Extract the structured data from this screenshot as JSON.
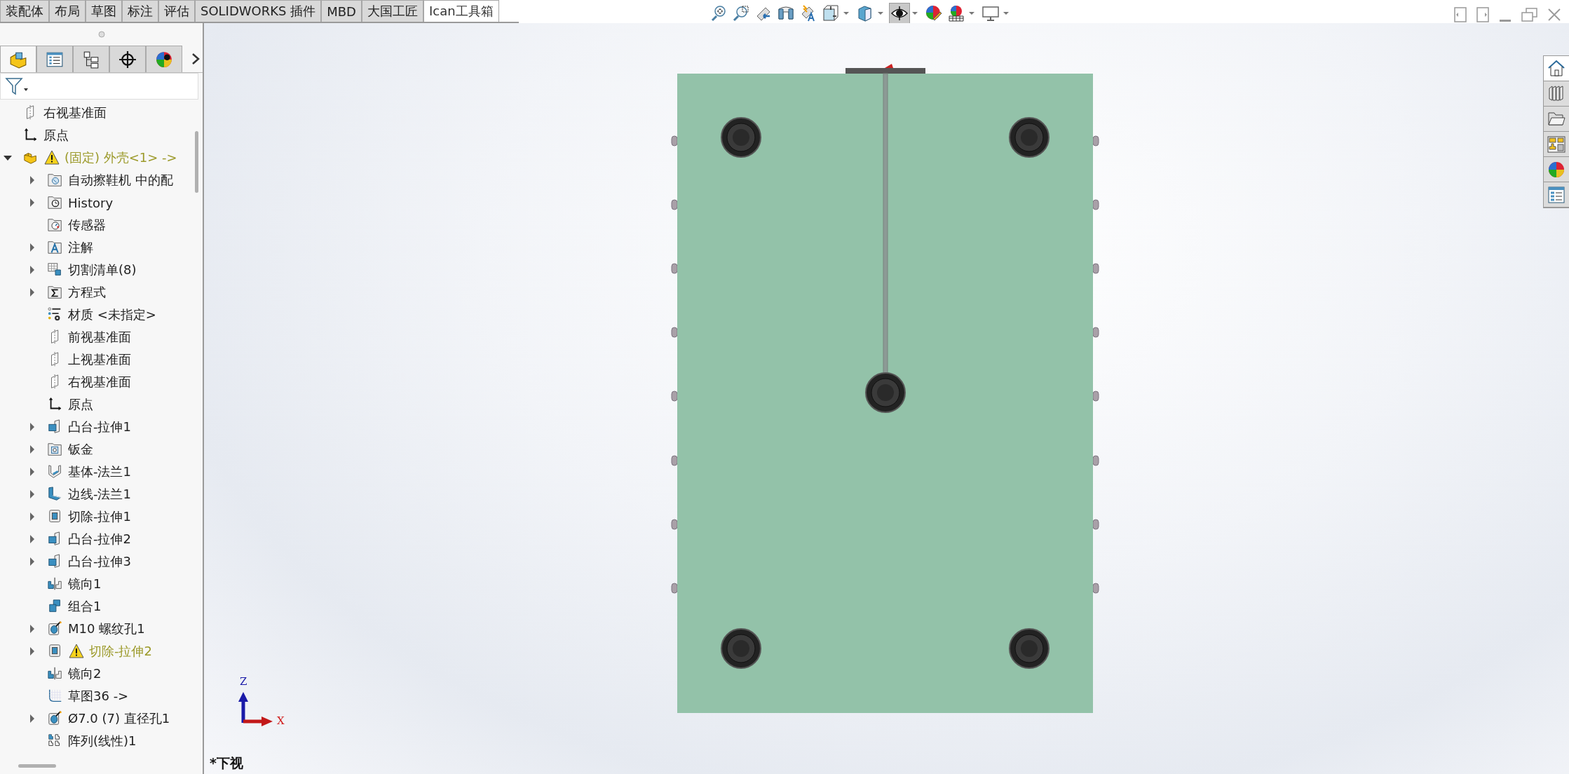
{
  "tabs": [
    {
      "label": "装配体",
      "selected": false
    },
    {
      "label": "布局",
      "selected": false
    },
    {
      "label": "草图",
      "selected": false
    },
    {
      "label": "标注",
      "selected": false
    },
    {
      "label": "评估",
      "selected": false
    },
    {
      "label": "SOLIDWORKS 插件",
      "selected": false
    },
    {
      "label": "MBD",
      "selected": false
    },
    {
      "label": "大国工匠",
      "selected": false
    },
    {
      "label": "Ican工具箱",
      "selected": true
    }
  ],
  "toolbar": [
    {
      "kind": "zoom-fit",
      "pressed": false
    },
    {
      "kind": "zoom-area",
      "pressed": false
    },
    {
      "kind": "previous-view",
      "pressed": false
    },
    {
      "kind": "section-view",
      "pressed": false
    },
    {
      "kind": "dynamic-annotation",
      "pressed": false
    },
    {
      "kind": "view-orientation",
      "dropdown": true,
      "pressed": false
    },
    {
      "kind": "display-style",
      "dropdown": true,
      "pressed": false
    },
    {
      "kind": "hide-show",
      "dropdown": true,
      "pressed": true
    },
    {
      "kind": "edit-appearance",
      "pressed": false
    },
    {
      "kind": "scene",
      "dropdown": true,
      "pressed": false
    },
    {
      "kind": "view-settings",
      "dropdown": true,
      "pressed": false
    }
  ],
  "panel_tabs": [
    {
      "kind": "feature-tree",
      "selected": true
    },
    {
      "kind": "property",
      "selected": false
    },
    {
      "kind": "configuration",
      "selected": false
    },
    {
      "kind": "dimxpert",
      "selected": false
    },
    {
      "kind": "display",
      "selected": false
    }
  ],
  "tree": [
    {
      "label": "右视基准面",
      "kind": "plane"
    },
    {
      "label": "原点",
      "kind": "origin"
    },
    {
      "label": "(固定) 外壳<1> ->",
      "kind": "part",
      "expanded": true,
      "warning": true,
      "children": [
        {
          "label": "自动擦鞋机 中的配",
          "kind": "mates",
          "expanded": false
        },
        {
          "label": "History",
          "kind": "history",
          "expanded": false
        },
        {
          "label": "传感器",
          "kind": "sensor"
        },
        {
          "label": "注解",
          "kind": "annotation",
          "expanded": false
        },
        {
          "label": "切割清单(8)",
          "kind": "cutlist",
          "expanded": false
        },
        {
          "label": "方程式",
          "kind": "equation",
          "expanded": false
        },
        {
          "label": "材质 <未指定>",
          "kind": "material"
        },
        {
          "label": "前视基准面",
          "kind": "plane"
        },
        {
          "label": "上视基准面",
          "kind": "plane"
        },
        {
          "label": "右视基准面",
          "kind": "plane"
        },
        {
          "label": "原点",
          "kind": "origin"
        },
        {
          "label": "凸台-拉伸1",
          "kind": "boss",
          "expanded": false
        },
        {
          "label": "钣金",
          "kind": "sheetmetal",
          "expanded": false
        },
        {
          "label": "基体-法兰1",
          "kind": "baseflange",
          "expanded": false
        },
        {
          "label": "边线-法兰1",
          "kind": "edgeflange",
          "expanded": false
        },
        {
          "label": "切除-拉伸1",
          "kind": "cut",
          "expanded": false
        },
        {
          "label": "凸台-拉伸2",
          "kind": "boss",
          "expanded": false
        },
        {
          "label": "凸台-拉伸3",
          "kind": "boss",
          "expanded": false
        },
        {
          "label": "镜向1",
          "kind": "mirror"
        },
        {
          "label": "组合1",
          "kind": "combine"
        },
        {
          "label": "M10 螺纹孔1",
          "kind": "hole",
          "expanded": false
        },
        {
          "label": "切除-拉伸2",
          "kind": "cut",
          "expanded": false,
          "warning": true
        },
        {
          "label": "镜向2",
          "kind": "mirror"
        },
        {
          "label": "草图36 ->",
          "kind": "sketch"
        },
        {
          "label": "Ø7.0 (7) 直径孔1",
          "kind": "hole",
          "expanded": false
        },
        {
          "label": "阵列(线性)1",
          "kind": "pattern"
        }
      ]
    }
  ],
  "task_pane": [
    {
      "kind": "home",
      "selected": true
    },
    {
      "kind": "library",
      "selected": false
    },
    {
      "kind": "file-explorer",
      "selected": false
    },
    {
      "kind": "palette",
      "selected": false
    },
    {
      "kind": "appearances",
      "selected": false
    },
    {
      "kind": "custom-properties",
      "selected": false
    }
  ],
  "axes": {
    "z_label": "Z",
    "x_label": "X"
  },
  "view_label": "*下视"
}
